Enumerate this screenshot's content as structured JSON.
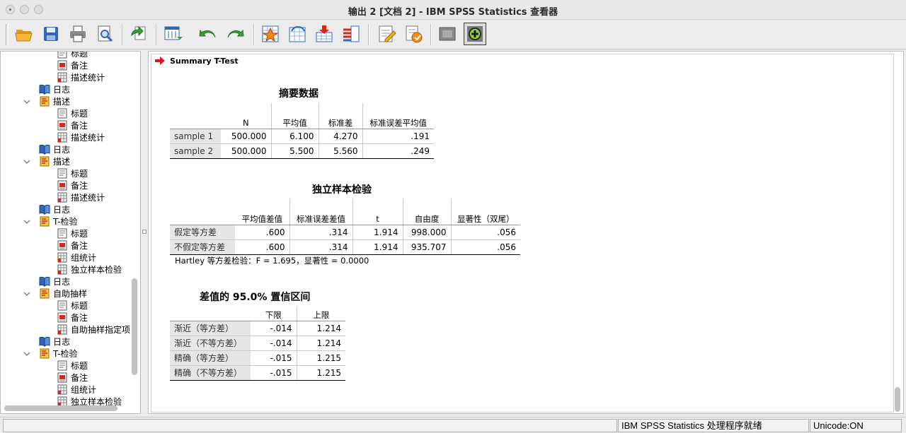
{
  "window": {
    "title": "输出 2 [文档 2] - IBM SPSS Statistics 查看器"
  },
  "toolbar": {
    "buttons": [
      "open-icon",
      "save-icon",
      "print-icon",
      "print-preview-icon",
      "export-icon",
      "goto-data-icon",
      "undo-icon",
      "redo-icon",
      "goto-case-icon",
      "goto-variable-icon",
      "insert-case-icon",
      "variables-icon",
      "edit-icon",
      "insert-output-icon",
      "hide-icon",
      "promote-icon"
    ]
  },
  "tree": {
    "items": [
      {
        "label": "标题",
        "icon": "title-icon",
        "level": 2,
        "expand": false,
        "partial": true
      },
      {
        "label": "备注",
        "icon": "notes-icon",
        "level": 2,
        "expand": false
      },
      {
        "label": "描述统计",
        "icon": "table-icon",
        "level": 2,
        "expand": false
      },
      {
        "label": "日志",
        "icon": "log-icon",
        "level": 1,
        "expand": false
      },
      {
        "label": "描述",
        "icon": "procedure-icon",
        "level": 1,
        "expand": true
      },
      {
        "label": "标题",
        "icon": "title-icon",
        "level": 2,
        "expand": false
      },
      {
        "label": "备注",
        "icon": "notes-icon",
        "level": 2,
        "expand": false
      },
      {
        "label": "描述统计",
        "icon": "table-icon",
        "level": 2,
        "expand": false
      },
      {
        "label": "日志",
        "icon": "log-icon",
        "level": 1,
        "expand": false
      },
      {
        "label": "描述",
        "icon": "procedure-icon",
        "level": 1,
        "expand": true
      },
      {
        "label": "标题",
        "icon": "title-icon",
        "level": 2,
        "expand": false
      },
      {
        "label": "备注",
        "icon": "notes-icon",
        "level": 2,
        "expand": false
      },
      {
        "label": "描述统计",
        "icon": "table-icon",
        "level": 2,
        "expand": false
      },
      {
        "label": "日志",
        "icon": "log-icon",
        "level": 1,
        "expand": false
      },
      {
        "label": "T-检验",
        "icon": "procedure-icon",
        "level": 1,
        "expand": true
      },
      {
        "label": "标题",
        "icon": "title-icon",
        "level": 2,
        "expand": false
      },
      {
        "label": "备注",
        "icon": "notes-icon",
        "level": 2,
        "expand": false
      },
      {
        "label": "组统计",
        "icon": "table-icon",
        "level": 2,
        "expand": false
      },
      {
        "label": "独立样本检验",
        "icon": "table-icon",
        "level": 2,
        "expand": false
      },
      {
        "label": "日志",
        "icon": "log-icon",
        "level": 1,
        "expand": false
      },
      {
        "label": "自助抽样",
        "icon": "procedure-icon",
        "level": 1,
        "expand": true
      },
      {
        "label": "标题",
        "icon": "title-icon",
        "level": 2,
        "expand": false
      },
      {
        "label": "备注",
        "icon": "notes-icon",
        "level": 2,
        "expand": false
      },
      {
        "label": "自助抽样指定项",
        "icon": "table-icon",
        "level": 2,
        "expand": false
      },
      {
        "label": "日志",
        "icon": "log-icon",
        "level": 1,
        "expand": false
      },
      {
        "label": "T-检验",
        "icon": "procedure-icon",
        "level": 1,
        "expand": true
      },
      {
        "label": "标题",
        "icon": "title-icon",
        "level": 2,
        "expand": false
      },
      {
        "label": "备注",
        "icon": "notes-icon",
        "level": 2,
        "expand": false
      },
      {
        "label": "组统计",
        "icon": "table-icon",
        "level": 2,
        "expand": false
      },
      {
        "label": "独立样本检验",
        "icon": "table-icon",
        "level": 2,
        "expand": false,
        "partial": true
      }
    ]
  },
  "output": {
    "heading": "Summary T-Test",
    "summary": {
      "title": "摘要数据",
      "headers": [
        "N",
        "平均值",
        "标准差",
        "标准误差平均值"
      ],
      "rows": [
        {
          "label": "sample 1",
          "cells": [
            "500.000",
            "6.100",
            "4.270",
            ".191"
          ]
        },
        {
          "label": "sample 2",
          "cells": [
            "500.000",
            "5.500",
            "5.560",
            ".249"
          ]
        }
      ]
    },
    "independent": {
      "title": "独立样本检验",
      "headers": [
        "平均值差值",
        "标准误差差值",
        "t",
        "自由度",
        "显著性（双尾）"
      ],
      "rows": [
        {
          "label": "假定等方差",
          "cells": [
            ".600",
            ".314",
            "1.914",
            "998.000",
            ".056"
          ]
        },
        {
          "label": "不假定等方差",
          "cells": [
            ".600",
            ".314",
            "1.914",
            "935.707",
            ".056"
          ]
        }
      ],
      "footnote": "Hartley 等方差检验：F = 1.695，显著性 = 0.0000"
    },
    "ci": {
      "title": "差值的 95.0% 置信区间",
      "headers": [
        "下限",
        "上限"
      ],
      "rows": [
        {
          "label": "渐近（等方差）",
          "cells": [
            "-.014",
            "1.214"
          ]
        },
        {
          "label": "渐近（不等方差）",
          "cells": [
            "-.014",
            "1.214"
          ]
        },
        {
          "label": "精确（等方差）",
          "cells": [
            "-.015",
            "1.215"
          ]
        },
        {
          "label": "精确（不等方差）",
          "cells": [
            "-.015",
            "1.215"
          ]
        }
      ]
    }
  },
  "status": {
    "processor": "IBM SPSS Statistics 处理程序就绪",
    "unicode": "Unicode:ON"
  }
}
